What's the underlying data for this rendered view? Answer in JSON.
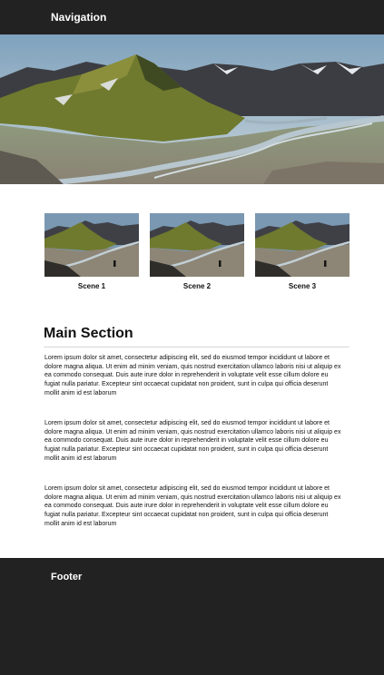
{
  "nav": {
    "title": "Navigation"
  },
  "hero": {
    "image": "mountain-valley-landscape"
  },
  "thumbnails": [
    {
      "caption": "Scene 1",
      "image": "mountain-valley-with-person"
    },
    {
      "caption": "Scene 2",
      "image": "mountain-valley-with-person"
    },
    {
      "caption": "Scene 3",
      "image": "mountain-valley-with-person"
    }
  ],
  "main": {
    "heading": "Main Section",
    "paragraphs": [
      "Lorem ipsum dolor sit amet, consectetur adipiscing elit, sed do eiusmod tempor incididunt ut labore et dolore magna aliqua. Ut enim ad minim veniam, quis nostrud exercitation ullamco laboris nisi ut aliquip ex ea commodo consequat. Duis aute irure dolor in reprehenderit in voluptate velit esse cillum dolore eu fugiat nulla pariatur. Excepteur sint occaecat cupidatat non proident, sunt in culpa qui officia deserunt mollit anim id est laborum",
      "Lorem ipsum dolor sit amet, consectetur adipiscing elit, sed do eiusmod tempor incididunt ut labore et dolore magna aliqua. Ut enim ad minim veniam, quis nostrud exercitation ullamco laboris nisi ut aliquip ex ea commodo consequat. Duis aute irure dolor in reprehenderit in voluptate velit esse cillum dolore eu fugiat nulla pariatur. Excepteur sint occaecat cupidatat non proident, sunt in culpa qui officia deserunt mollit anim id est laborum",
      "Lorem ipsum dolor sit amet, consectetur adipiscing elit, sed do eiusmod tempor incididunt ut labore et dolore magna aliqua. Ut enim ad minim veniam, quis nostrud exercitation ullamco laboris nisi ut aliquip ex ea commodo consequat. Duis aute irure dolor in reprehenderit in voluptate velit esse cillum dolore eu fugiat nulla pariatur. Excepteur sint occaecat cupidatat non proident, sunt in culpa qui officia deserunt mollit anim id est laborum"
    ]
  },
  "footer": {
    "title": "Footer"
  },
  "colors": {
    "bar_background": "#222222",
    "bar_text": "#ffffff",
    "body_text": "#111111",
    "rule": "#d6d6d6"
  }
}
